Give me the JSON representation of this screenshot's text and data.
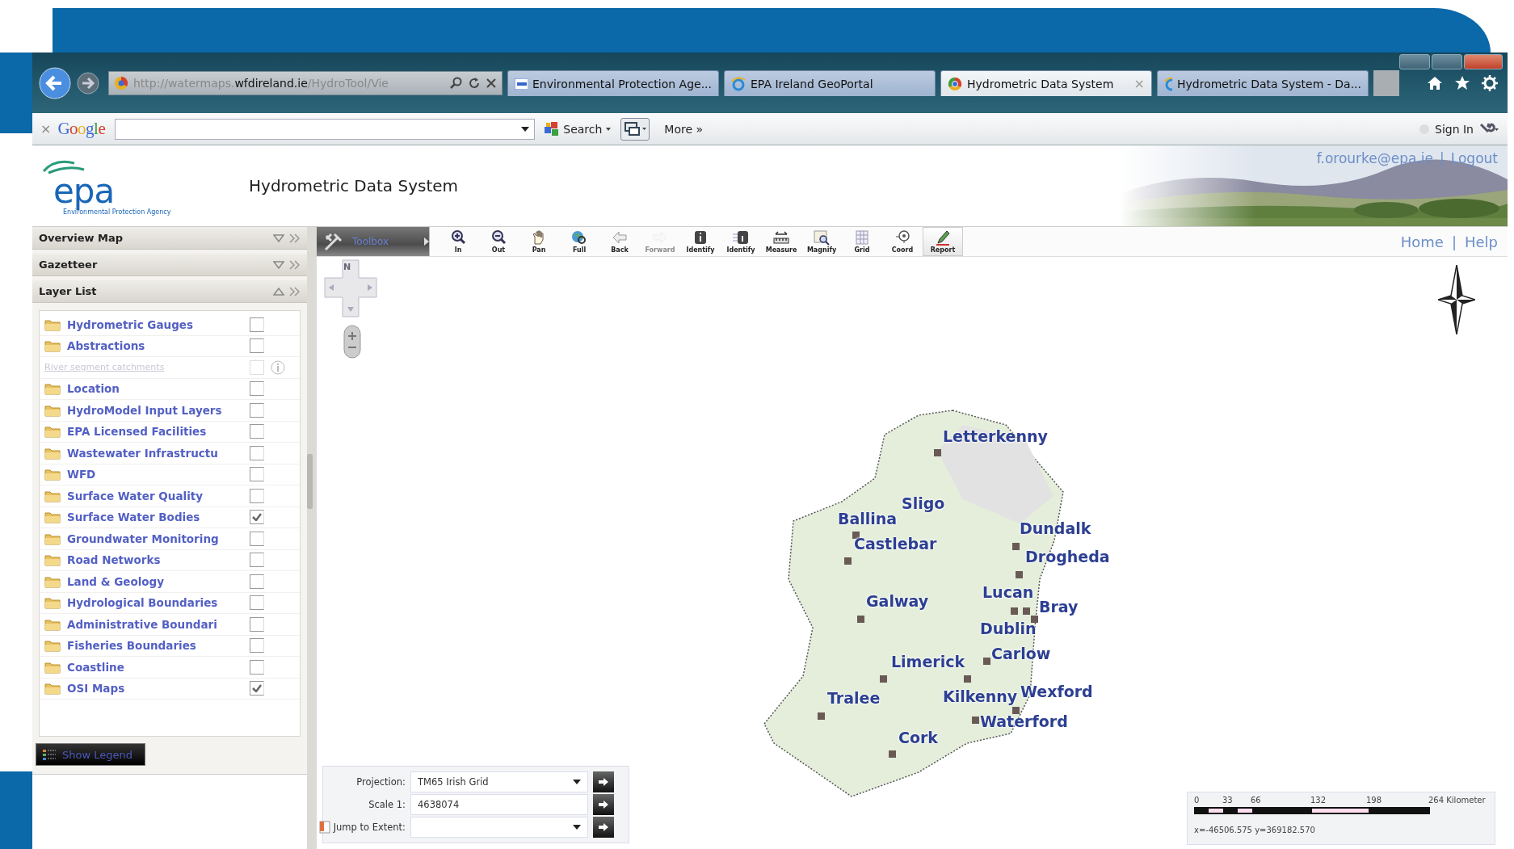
{
  "browser": {
    "address": "http://watermaps.**wfdireland.ie**/HydroTool/Vie",
    "tabs": [
      {
        "title": "Environmental Protection Age...",
        "selected": false
      },
      {
        "title": "EPA Ireland GeoPortal",
        "selected": false
      },
      {
        "title": "Hydrometric Data System",
        "selected": true,
        "close": "×"
      },
      {
        "title": "Hydrometric Data System - Da...",
        "selected": false
      }
    ]
  },
  "google_toolbar": {
    "close": "×",
    "logo": "Google",
    "search_button": "Search",
    "more": "More »",
    "sign_in": "Sign In"
  },
  "header": {
    "logo": "epa",
    "logo_caption": "Environmental Protection Agency",
    "title": "Hydrometric Data System",
    "user": "f.orourke@epa.ie",
    "divider": "|",
    "logout": "Logout"
  },
  "sidebar": {
    "panels": [
      {
        "title": "Overview Map",
        "expanded": false
      },
      {
        "title": "Gazetteer",
        "expanded": false
      },
      {
        "title": "Layer List",
        "expanded": true
      }
    ],
    "layers": [
      {
        "label": "Hydrometric Gauges",
        "kind": "folder",
        "disabled": false,
        "checked": false
      },
      {
        "label": "Abstractions",
        "kind": "folder",
        "disabled": false,
        "checked": false
      },
      {
        "label": "River segment catchments",
        "kind": "layer",
        "disabled": true,
        "checked": false
      },
      {
        "label": "Location",
        "kind": "folder",
        "disabled": false,
        "checked": false
      },
      {
        "label": "HydroModel Input Layers",
        "kind": "folder",
        "disabled": false,
        "checked": false
      },
      {
        "label": "EPA Licensed Facilities",
        "kind": "folder",
        "disabled": false,
        "checked": false
      },
      {
        "label": "Wastewater Infrastructu",
        "kind": "folder",
        "disabled": false,
        "checked": false
      },
      {
        "label": "WFD",
        "kind": "folder",
        "disabled": false,
        "checked": false
      },
      {
        "label": "Surface Water Quality",
        "kind": "folder",
        "disabled": false,
        "checked": false
      },
      {
        "label": "Surface Water Bodies",
        "kind": "folder",
        "disabled": false,
        "checked": true
      },
      {
        "label": "Groundwater Monitoring",
        "kind": "folder",
        "disabled": false,
        "checked": false
      },
      {
        "label": "Road Networks",
        "kind": "folder",
        "disabled": false,
        "checked": false
      },
      {
        "label": "Land & Geology",
        "kind": "folder",
        "disabled": false,
        "checked": false
      },
      {
        "label": "Hydrological Boundaries",
        "kind": "folder",
        "disabled": false,
        "checked": false
      },
      {
        "label": "Administrative Boundari",
        "kind": "folder",
        "disabled": false,
        "checked": false
      },
      {
        "label": "Fisheries Boundaries",
        "kind": "folder",
        "disabled": false,
        "checked": false
      },
      {
        "label": "Coastline",
        "kind": "folder",
        "disabled": false,
        "checked": false
      },
      {
        "label": "OSI Maps",
        "kind": "folder",
        "disabled": false,
        "checked": true
      }
    ],
    "show_legend": "Show Legend"
  },
  "toolbar": {
    "toolbox": "Toolbox",
    "tools": [
      {
        "label": "In",
        "disabled": false,
        "selected": false
      },
      {
        "label": "Out",
        "disabled": false,
        "selected": false
      },
      {
        "label": "Pan",
        "disabled": false,
        "selected": false
      },
      {
        "label": "Full",
        "disabled": false,
        "selected": false
      },
      {
        "label": "Back",
        "disabled": false,
        "selected": false
      },
      {
        "label": "Forward",
        "disabled": true,
        "selected": false
      },
      {
        "label": "Identify",
        "disabled": false,
        "selected": false
      },
      {
        "label": "Identify",
        "disabled": false,
        "selected": false
      },
      {
        "label": "Measure",
        "disabled": false,
        "selected": false
      },
      {
        "label": "Magnify",
        "disabled": false,
        "selected": false
      },
      {
        "label": "Grid",
        "disabled": false,
        "selected": false
      },
      {
        "label": "Coord",
        "disabled": false,
        "selected": false
      },
      {
        "label": "Report",
        "disabled": false,
        "selected": true
      }
    ],
    "nav": [
      "Home",
      "|",
      "Help"
    ]
  },
  "map": {
    "pan_north": "N",
    "towns": [
      "Letterkenny",
      "Sligo",
      "Ballina",
      "Castlebar",
      "Dundalk",
      "Drogheda",
      "Galway",
      "Lucan",
      "Bray",
      "Dublin",
      "Carlow",
      "Limerick",
      "Tralee",
      "Kilkenny",
      "Wexford",
      "Waterford",
      "Cork"
    ]
  },
  "map_controls": {
    "projection": {
      "label": "Projection:",
      "value": "TM65 Irish Grid"
    },
    "scale": {
      "label": "Scale 1:",
      "value": "4638074"
    },
    "jump": {
      "label": "Jump to Extent:"
    }
  },
  "scale_bar": {
    "ticks": [
      "0",
      "33",
      "66",
      "132",
      "198",
      "264 Kilometer"
    ],
    "coords": "x=-46506.575 y=369182.570"
  }
}
